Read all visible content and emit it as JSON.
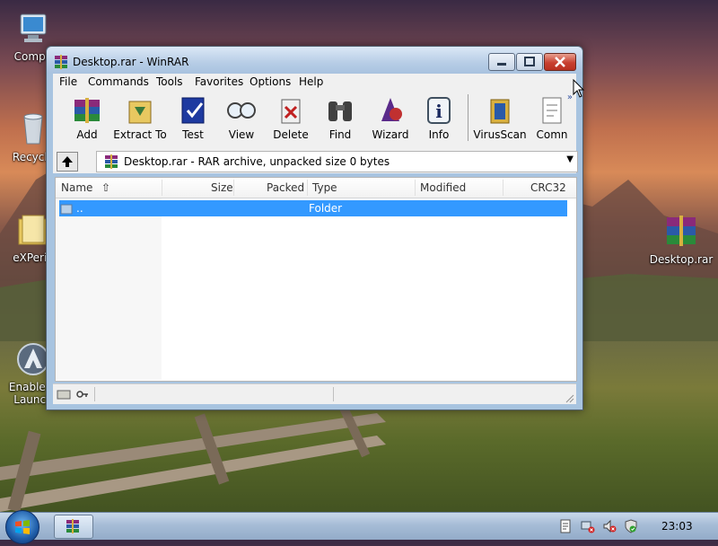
{
  "desktop": {
    "icons": [
      {
        "label": "Compu",
        "icon": "computer-icon"
      },
      {
        "label": "Recycle",
        "icon": "recycle-bin-icon"
      },
      {
        "label": "eXPerie",
        "icon": "folder-icon"
      },
      {
        "label": "Enable Q\nLaunch",
        "icon": "quick-launch-icon"
      },
      {
        "label": "Desktop.rar",
        "icon": "winrar-archive-icon"
      }
    ]
  },
  "window": {
    "title": "Desktop.rar - WinRAR",
    "controls": [
      "minimize",
      "maximize",
      "close"
    ],
    "menu": [
      "File",
      "Commands",
      "Tools",
      "Favorites",
      "Options",
      "Help"
    ],
    "toolbar": [
      {
        "label": "Add",
        "icon": "add-icon"
      },
      {
        "label": "Extract To",
        "icon": "extract-icon"
      },
      {
        "label": "Test",
        "icon": "test-icon"
      },
      {
        "label": "View",
        "icon": "view-icon"
      },
      {
        "label": "Delete",
        "icon": "delete-icon"
      },
      {
        "label": "Find",
        "icon": "find-icon"
      },
      {
        "label": "Wizard",
        "icon": "wizard-icon"
      },
      {
        "label": "Info",
        "icon": "info-icon"
      },
      {
        "label": "VirusScan",
        "icon": "virusscan-icon"
      },
      {
        "label": "Comn",
        "icon": "comment-icon"
      }
    ],
    "address": "Desktop.rar - RAR archive, unpacked size 0 bytes",
    "columns": [
      "Name",
      "Size",
      "Packed",
      "Type",
      "Modified",
      "CRC32"
    ],
    "rows": [
      {
        "name": "..",
        "size": "",
        "packed": "",
        "type": "Folder",
        "modified": "",
        "crc": ""
      }
    ]
  },
  "taskbar": {
    "clock": "23:03"
  }
}
